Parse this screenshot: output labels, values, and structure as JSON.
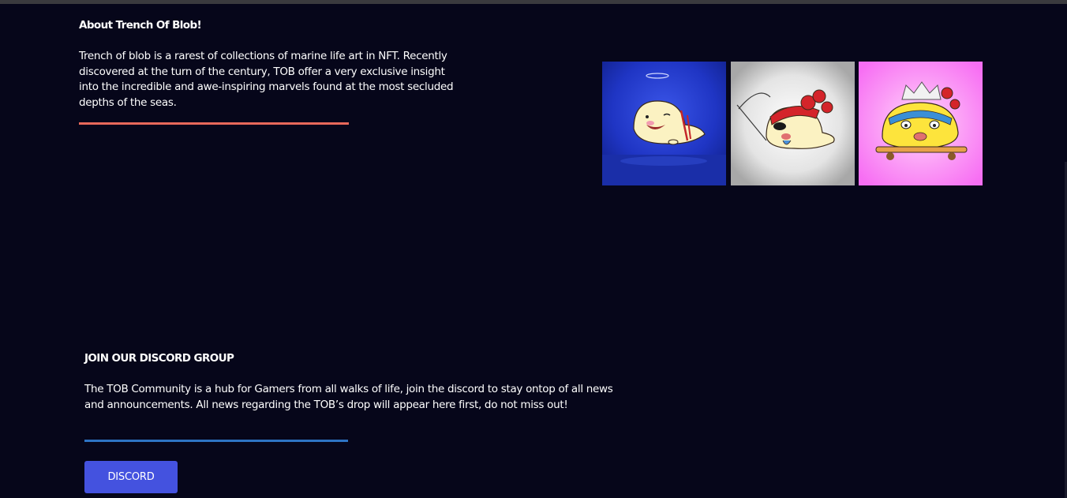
{
  "about": {
    "title": "About Trench Of Blob!",
    "body": "Trench of blob is a rarest of collections of marine life art in NFT. Recently discovered at the turn of the century, TOB offer a very exclusive insight into the incredible and awe-inspiring marvels found at the most secluded depths of the seas."
  },
  "gallery": {
    "images": [
      {
        "icon": "angel-blob-nft-image",
        "background": "#1f35c4"
      },
      {
        "icon": "pirate-blob-nft-image",
        "background": "#cfcfcf"
      },
      {
        "icon": "skater-blob-nft-image",
        "background": "#f77ef5"
      }
    ]
  },
  "discord": {
    "title": "JOIN OUR DISCORD GROUP",
    "body": "The TOB Community is a hub for Gamers from all walks of life, join the discord to stay ontop of all news and announcements. All news regarding the TOB’s drop will appear here first, do not miss out!",
    "button_label": "DISCORD"
  },
  "colors": {
    "background": "#06061a",
    "about_rule": "#e8685a",
    "discord_rule": "#2d74c4",
    "button": "#4452df"
  }
}
